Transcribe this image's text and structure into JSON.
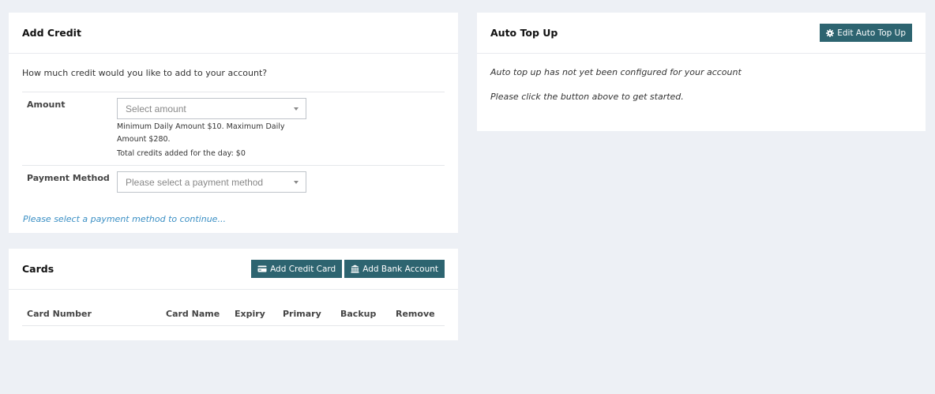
{
  "add_credit": {
    "title": "Add Credit",
    "question": "How much credit would you like to add to your account?",
    "amount": {
      "label": "Amount",
      "placeholder": "Select amount",
      "help_line1": "Minimum Daily Amount $10. Maximum Daily Amount $280.",
      "help_line2": "Total credits added for the day: $0"
    },
    "payment": {
      "label": "Payment Method",
      "placeholder": "Please select a payment method"
    },
    "continue_message": "Please select a payment method to continue..."
  },
  "cards": {
    "title": "Cards",
    "add_card_label": "Add Credit Card",
    "add_bank_label": "Add Bank Account",
    "columns": [
      "Card Number",
      "Card Name",
      "Expiry",
      "Primary",
      "Backup",
      "Remove"
    ]
  },
  "auto_top_up": {
    "title": "Auto Top Up",
    "edit_label": "Edit Auto Top Up",
    "line1": "Auto top up has not yet been configured for your account",
    "line2": "Please click the button above to get started."
  },
  "colors": {
    "background": "#edf0f5",
    "button": "#2d6470",
    "link": "#3a8fc4"
  },
  "icons": {
    "add_card": "credit-card-icon",
    "add_bank": "bank-icon",
    "edit": "gear-icon"
  }
}
